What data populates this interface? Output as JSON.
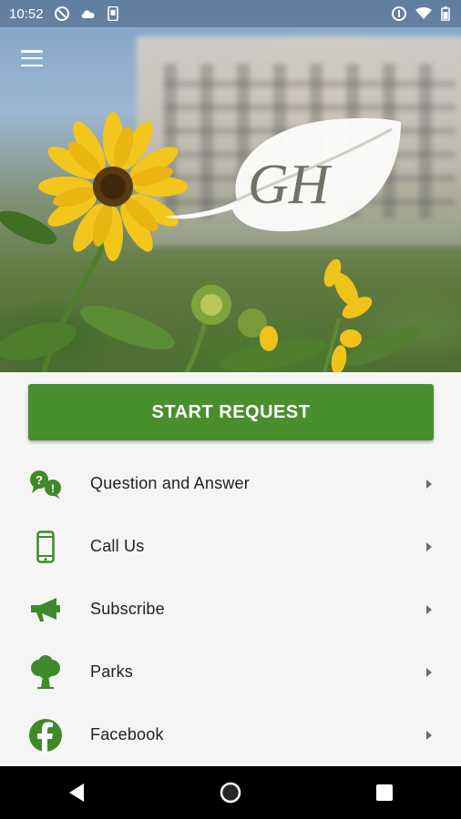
{
  "status_bar": {
    "time": "10:52",
    "left_icons": [
      "do-not-disturb-icon",
      "cloud-icon",
      "phone-icon"
    ],
    "right_icons": [
      "location-circle-icon",
      "wifi-icon",
      "battery-icon"
    ]
  },
  "hero": {
    "logo_text": "GH",
    "menu_icon": "hamburger-menu-icon"
  },
  "start_request": {
    "label": "START REQUEST"
  },
  "menu": {
    "items": [
      {
        "label": "Question and Answer",
        "icon": "question-answer-icon"
      },
      {
        "label": "Call Us",
        "icon": "mobile-phone-icon"
      },
      {
        "label": "Subscribe",
        "icon": "megaphone-icon"
      },
      {
        "label": "Parks",
        "icon": "tree-icon"
      },
      {
        "label": "Facebook",
        "icon": "facebook-icon"
      }
    ]
  },
  "nav_bar": {
    "buttons": [
      "back-icon",
      "home-icon",
      "recents-icon"
    ]
  },
  "colors": {
    "accent": "#4a8f2e",
    "icon_green": "#3e8a2a"
  }
}
